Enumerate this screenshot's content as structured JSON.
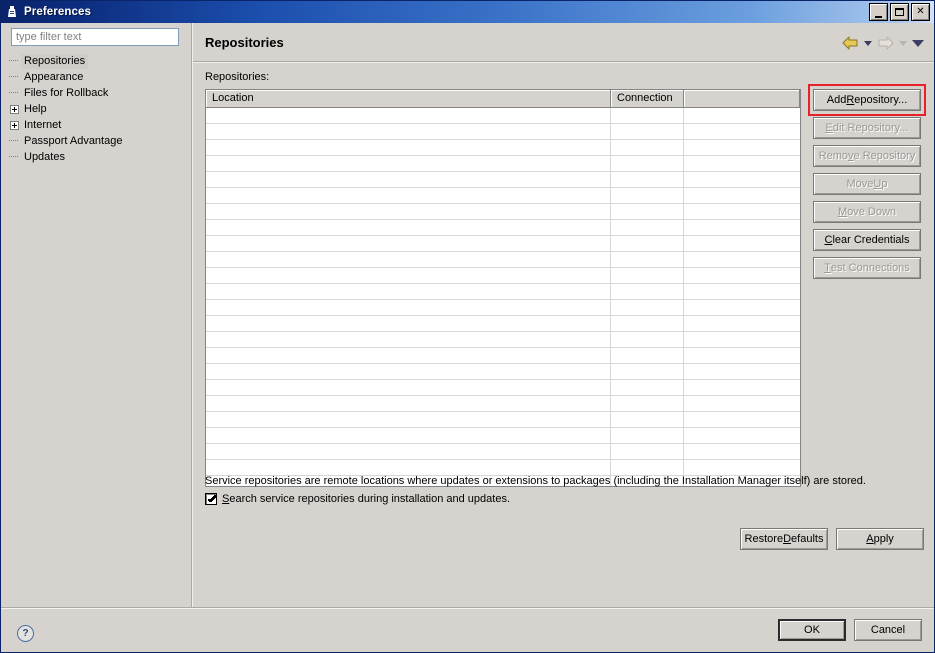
{
  "window": {
    "title": "Preferences",
    "icon": "app-icon",
    "controls": {
      "minimize": "_",
      "maximize": "□",
      "close": "✕"
    }
  },
  "sidebar": {
    "filter": {
      "placeholder": "type filter text",
      "value": ""
    },
    "items": [
      {
        "label": "Repositories",
        "expander": "none",
        "selected": true
      },
      {
        "label": "Appearance",
        "expander": "none",
        "selected": false
      },
      {
        "label": "Files for Rollback",
        "expander": "none",
        "selected": false
      },
      {
        "label": "Help",
        "expander": "plus",
        "selected": false
      },
      {
        "label": "Internet",
        "expander": "plus",
        "selected": false
      },
      {
        "label": "Passport Advantage",
        "expander": "none",
        "selected": false
      },
      {
        "label": "Updates",
        "expander": "none",
        "selected": false
      }
    ]
  },
  "page": {
    "title": "Repositories",
    "nav": {
      "back": "back-arrow",
      "back_menu": "back-dropdown",
      "forward": "forward-arrow",
      "forward_menu": "forward-dropdown",
      "view_menu": "view-menu-arrow"
    },
    "table_label": "Repositories:",
    "table": {
      "columns": [
        "Location",
        "Connection",
        ""
      ],
      "rows": [],
      "empty_row_count": 24
    },
    "side_buttons": [
      {
        "label": "Add Repository...",
        "pre": "Add ",
        "accel": "R",
        "post": "epository...",
        "enabled": true,
        "highlighted": true
      },
      {
        "label": "Edit Repository...",
        "pre": "",
        "accel": "E",
        "post": "dit Repository...",
        "enabled": false,
        "highlighted": false
      },
      {
        "label": "Remove Repository",
        "pre": "Remo",
        "accel": "v",
        "post": "e Repository",
        "enabled": false,
        "highlighted": false
      },
      {
        "label": "Move Up",
        "pre": "Move ",
        "accel": "U",
        "post": "p",
        "enabled": false,
        "highlighted": false
      },
      {
        "label": "Move Down",
        "pre": "",
        "accel": "M",
        "post": "ove Down",
        "enabled": false,
        "highlighted": false
      },
      {
        "label": "Clear Credentials",
        "pre": "",
        "accel": "C",
        "post": "lear Credentials",
        "enabled": true,
        "highlighted": false
      },
      {
        "label": "Test Connections",
        "pre": "",
        "accel": "T",
        "post": "est Connections",
        "enabled": false,
        "highlighted": false
      }
    ],
    "description": "Service repositories are remote locations where updates or extensions to packages (including the Installation Manager itself) are stored.",
    "checkbox": {
      "checked": true,
      "pre": "",
      "accel": "S",
      "post": "earch service repositories during installation and updates."
    },
    "restore_defaults": {
      "pre": "Restore ",
      "accel": "D",
      "post": "efaults"
    },
    "apply": {
      "pre": "",
      "accel": "A",
      "post": "pply"
    }
  },
  "footer": {
    "help_icon": "?",
    "ok": "OK",
    "cancel": "Cancel"
  },
  "colors": {
    "title_bar_start": "#0a246a",
    "title_bar_end": "#d6e2f5",
    "dialog_bg": "#d6d3ce",
    "highlight_box": "#e8202a",
    "selection": "#d0cdc8",
    "back_arrow": "#e8c85a",
    "forward_arrow": "#cfcbc4"
  }
}
